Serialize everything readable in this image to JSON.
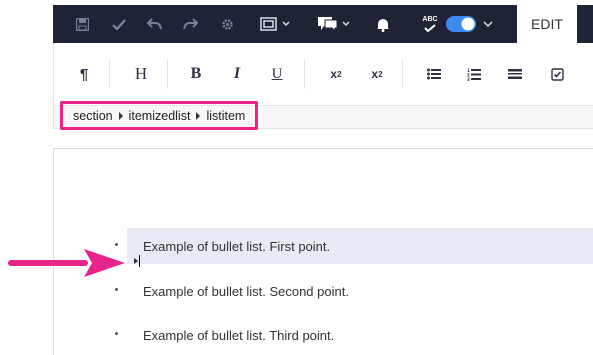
{
  "toolbar": {
    "tab_label": "EDIT",
    "icons": [
      "save-icon",
      "check-icon",
      "undo-icon",
      "redo-icon",
      "gear-icon",
      "fullscreen-icon",
      "comments-icon",
      "bell-icon",
      "spellcheck-icon"
    ],
    "spellcheck_badge": "ABC",
    "toggle_on": true,
    "toggle_color": "#3b8bf0"
  },
  "format": {
    "paragraph": "¶",
    "heading": "H",
    "bold": "B",
    "italic": "I",
    "underline": "U",
    "superscript_base": "x",
    "superscript_mark": "2",
    "subscript_base": "x",
    "subscript_mark": "2"
  },
  "breadcrumb": [
    "section",
    "itemizedlist",
    "listitem"
  ],
  "list_items": [
    "Example of bullet list. First point.",
    "Example of bullet list. Second point.",
    "Example of bullet list. Third point."
  ],
  "colors": {
    "toolbar_bg": "#1e2436",
    "highlight": "#e8238c",
    "row_highlight": "#e8ebf5"
  }
}
